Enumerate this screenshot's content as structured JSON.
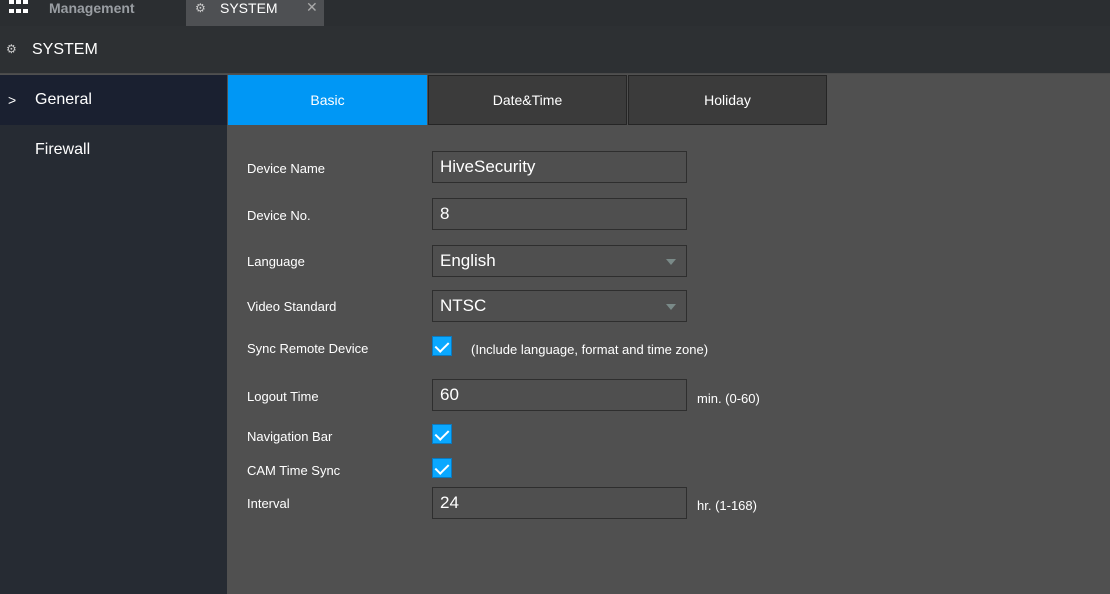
{
  "topbar": {
    "management_label": "Management",
    "tab_label": "SYSTEM",
    "close": "✕"
  },
  "header": {
    "title": "SYSTEM"
  },
  "sidebar": {
    "items": [
      {
        "label": "General",
        "active": true
      },
      {
        "label": "Firewall",
        "active": false
      }
    ]
  },
  "tabs": [
    {
      "label": "Basic",
      "active": true
    },
    {
      "label": "Date&Time"
    },
    {
      "label": "Holiday"
    }
  ],
  "form": {
    "device_name": {
      "label": "Device Name",
      "value": "HiveSecurity"
    },
    "device_no": {
      "label": "Device No.",
      "value": "8"
    },
    "language": {
      "label": "Language",
      "value": "English"
    },
    "video_standard": {
      "label": "Video Standard",
      "value": "NTSC"
    },
    "sync_remote": {
      "label": "Sync Remote Device",
      "checked": true,
      "note": "(Include language, format and time zone)"
    },
    "logout_time": {
      "label": "Logout Time",
      "value": "60",
      "unit": "min. (0-60)"
    },
    "navigation_bar": {
      "label": "Navigation Bar",
      "checked": true
    },
    "cam_time_sync": {
      "label": "CAM Time Sync",
      "checked": true
    },
    "interval": {
      "label": "Interval",
      "value": "24",
      "unit": "hr. (1-168)"
    }
  },
  "colors": {
    "accent": "#0097f5",
    "checkbox": "#0aa8ff",
    "content_bg": "#505050"
  }
}
